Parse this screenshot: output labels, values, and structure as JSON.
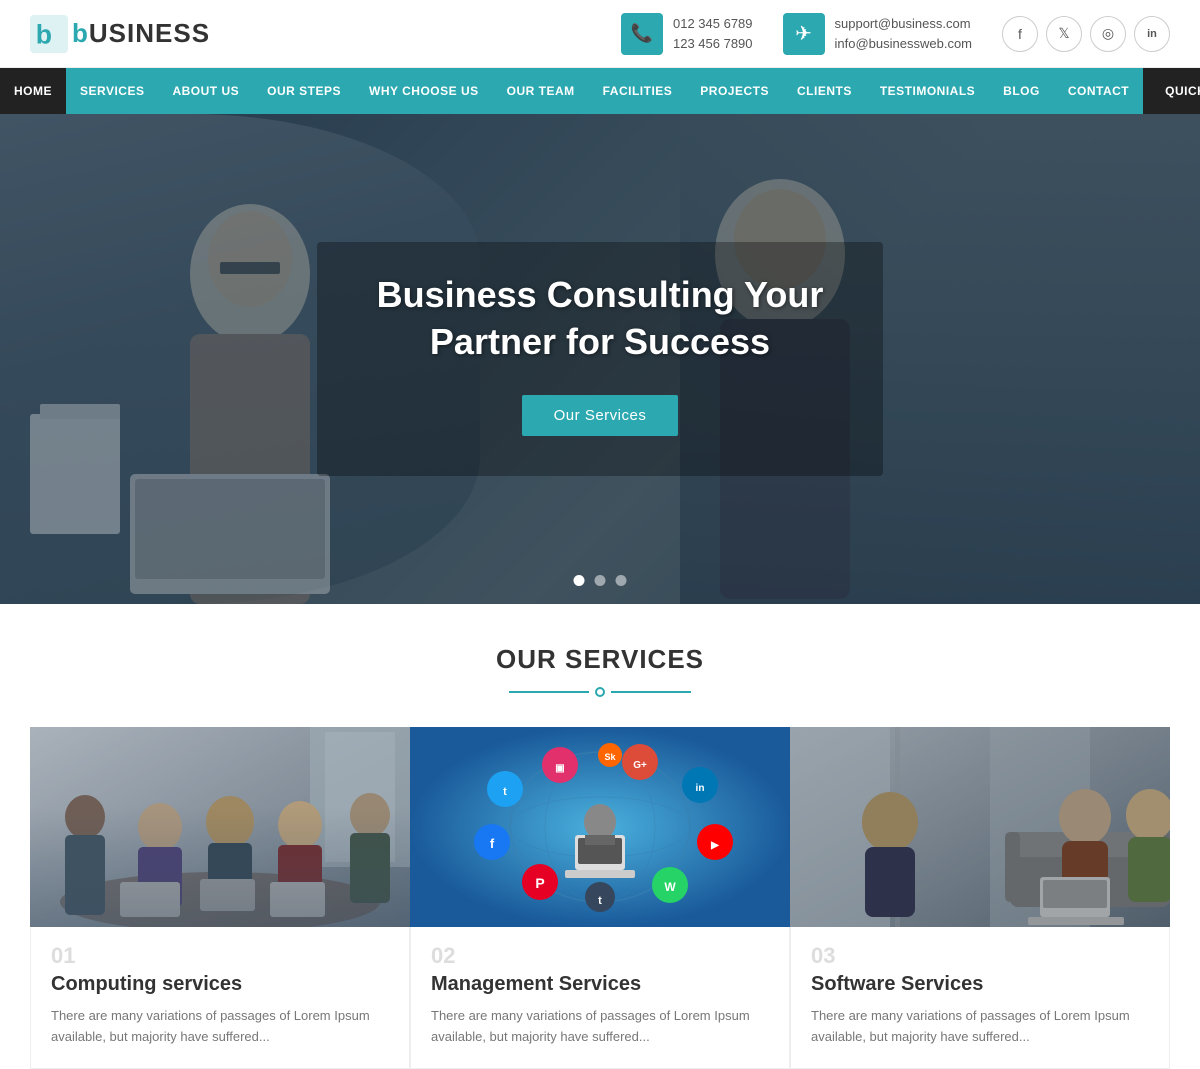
{
  "logo": {
    "icon_letter": "b",
    "name": "USINESS"
  },
  "topbar": {
    "phone1": "012 345 6789",
    "phone2": "123 456 7890",
    "email1": "support@business.com",
    "email2": "info@businessweb.com",
    "phone_icon": "📞",
    "email_icon": "✉"
  },
  "social": [
    {
      "name": "facebook",
      "icon": "f"
    },
    {
      "name": "twitter",
      "icon": "t"
    },
    {
      "name": "instagram",
      "icon": "◎"
    },
    {
      "name": "linkedin",
      "icon": "in"
    }
  ],
  "nav": {
    "items": [
      {
        "label": "HOME",
        "active": true
      },
      {
        "label": "SERVICES"
      },
      {
        "label": "ABOUT US"
      },
      {
        "label": "OUR STEPS"
      },
      {
        "label": "WHY CHOOSE US"
      },
      {
        "label": "OUR TEAM"
      },
      {
        "label": "FACILITIES"
      },
      {
        "label": "PROJECTS"
      },
      {
        "label": "CLIENTS"
      },
      {
        "label": "TESTIMONIALS"
      },
      {
        "label": "BLOG"
      },
      {
        "label": "CONTACT"
      }
    ],
    "quick_inquiry": "QUICK INQUIRY"
  },
  "hero": {
    "title_line1": "Business Consulting Your",
    "title_line2": "Partner for Success",
    "cta_button": "Our Services",
    "dots": [
      {
        "active": true
      },
      {
        "active": false
      },
      {
        "active": false
      }
    ]
  },
  "services_section": {
    "title": "OUR SERVICES",
    "cards": [
      {
        "number": "01",
        "title": "Computing services",
        "description": "There are many variations of passages of Lorem Ipsum available, but majority have suffered..."
      },
      {
        "number": "02",
        "title": "Management Services",
        "description": "There are many variations of passages of Lorem Ipsum available, but majority have suffered..."
      },
      {
        "number": "03",
        "title": "Software Services",
        "description": "There are many variations of passages of Lorem Ipsum available, but majority have suffered..."
      }
    ]
  }
}
